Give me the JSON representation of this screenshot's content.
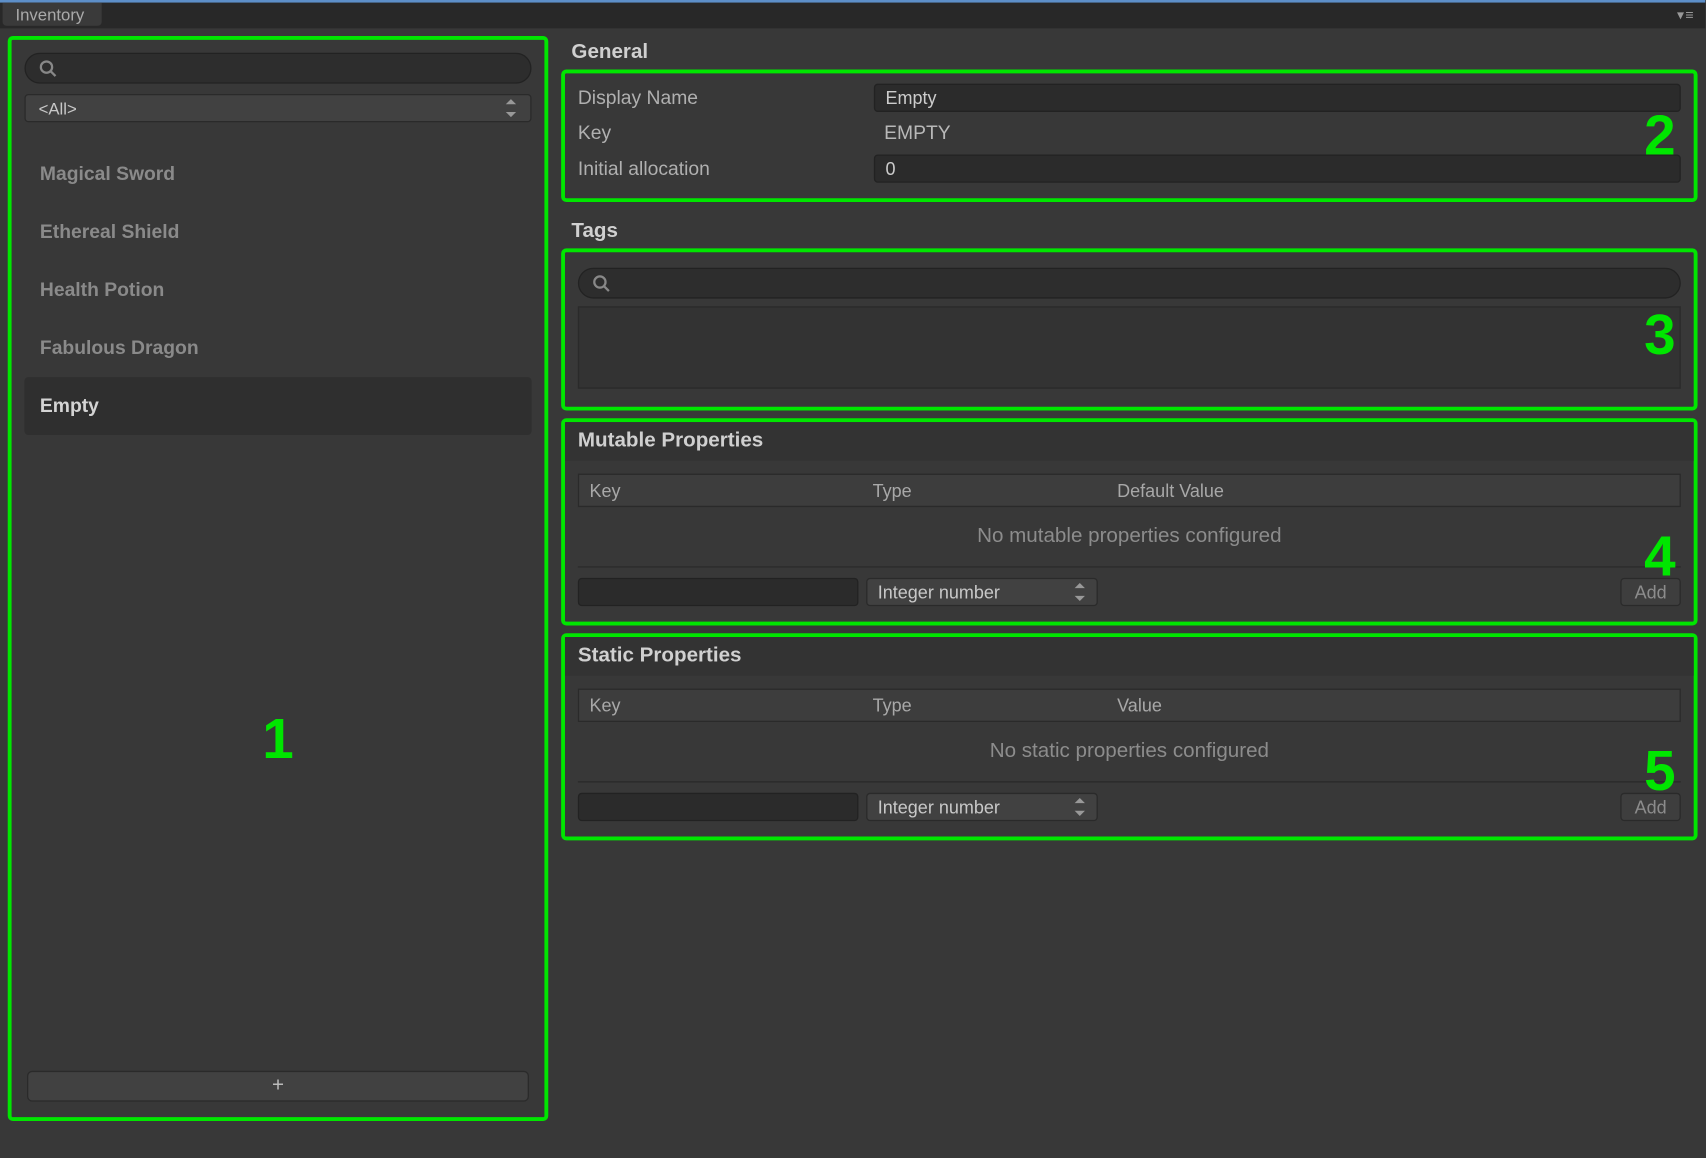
{
  "tab": {
    "title": "Inventory"
  },
  "callouts": {
    "n1": "1",
    "n2": "2",
    "n3": "3",
    "n4": "4",
    "n5": "5"
  },
  "sidebar": {
    "filter_selected": "<All>",
    "items": [
      {
        "label": "Magical Sword",
        "selected": false
      },
      {
        "label": "Ethereal Shield",
        "selected": false
      },
      {
        "label": "Health Potion",
        "selected": false
      },
      {
        "label": "Fabulous Dragon",
        "selected": false
      },
      {
        "label": "Empty",
        "selected": true
      }
    ],
    "add_label": "+"
  },
  "general": {
    "heading": "General",
    "display_name_label": "Display Name",
    "display_name_value": "Empty",
    "key_label": "Key",
    "key_value": "EMPTY",
    "initial_alloc_label": "Initial allocation",
    "initial_alloc_value": "0"
  },
  "tags": {
    "heading": "Tags"
  },
  "mutable": {
    "heading": "Mutable Properties",
    "col_key": "Key",
    "col_type": "Type",
    "col_val": "Default Value",
    "empty": "No mutable properties configured",
    "type_selected": "Integer number",
    "add_label": "Add"
  },
  "static": {
    "heading": "Static Properties",
    "col_key": "Key",
    "col_type": "Type",
    "col_val": "Value",
    "empty": "No static properties configured",
    "type_selected": "Integer number",
    "add_label": "Add"
  }
}
